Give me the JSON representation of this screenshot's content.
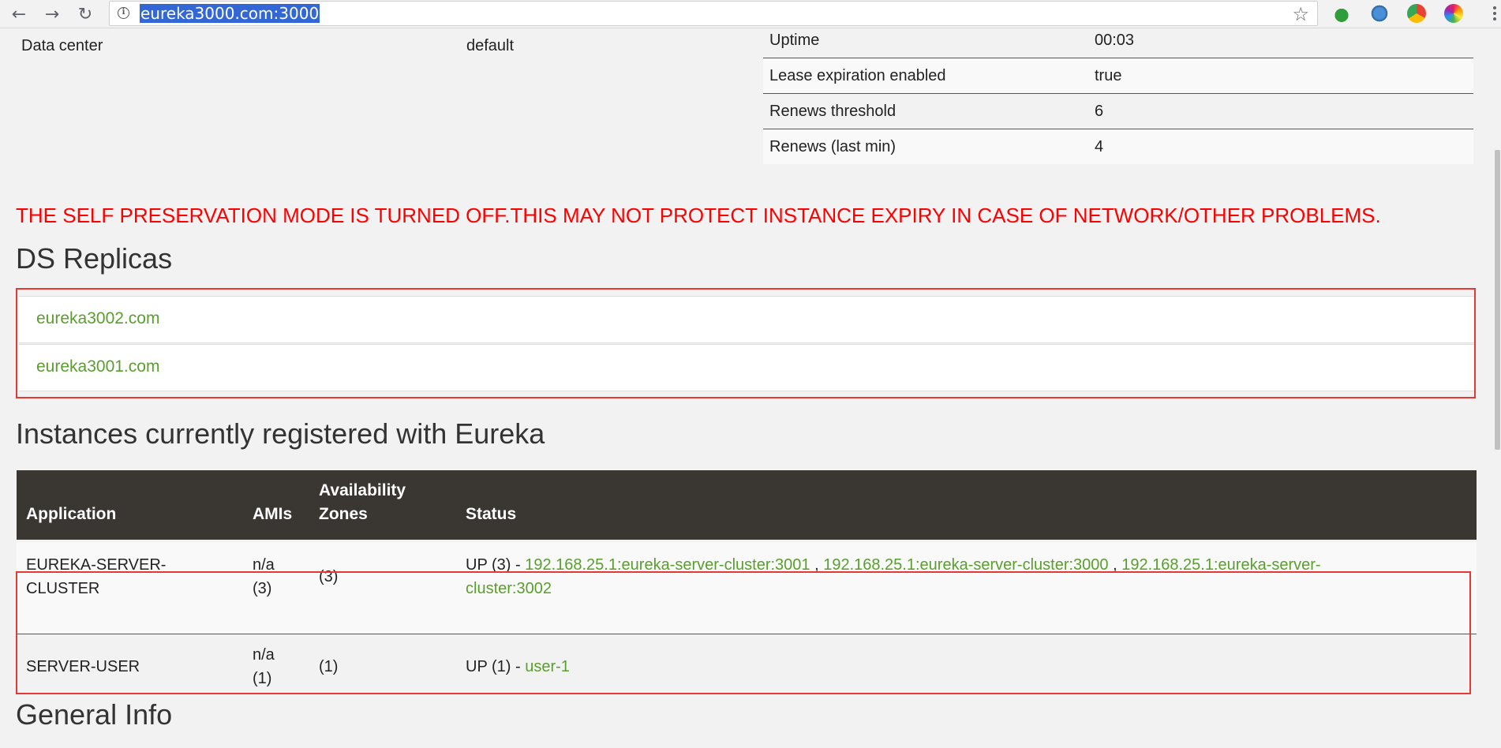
{
  "browser": {
    "url": "eureka3000.com:3000"
  },
  "top": {
    "data_center_label": "Data center",
    "data_center_value": "default",
    "stats": [
      {
        "key": "Uptime",
        "value": "00:03"
      },
      {
        "key": "Lease expiration enabled",
        "value": "true"
      },
      {
        "key": "Renews threshold",
        "value": "6"
      },
      {
        "key": "Renews (last min)",
        "value": "4"
      }
    ]
  },
  "warning": "THE SELF PRESERVATION MODE IS TURNED OFF.THIS MAY NOT PROTECT INSTANCE EXPIRY IN CASE OF NETWORK/OTHER PROBLEMS.",
  "replicas": {
    "title": "DS Replicas",
    "items": [
      "eureka3002.com",
      "eureka3001.com"
    ]
  },
  "instances": {
    "title": "Instances currently registered with Eureka",
    "headers": {
      "application": "Application",
      "amis": "AMIs",
      "zones_1": "Availability",
      "zones_2": "Zones",
      "status": "Status"
    },
    "rows": [
      {
        "application_1": "EUREKA-SERVER-",
        "application_2": "CLUSTER",
        "amis_1": "n/a",
        "amis_2": "(3)",
        "zones": "(3)",
        "status_prefix": "UP (3) - ",
        "link_1": "192.168.25.1:eureka-server-cluster:3001",
        "sep_1": " , ",
        "link_2": "192.168.25.1:eureka-server-cluster:3000",
        "sep_2": " , ",
        "link_3a": "192.168.25.1:eureka-server-",
        "link_3b": "cluster:3002"
      },
      {
        "application": "SERVER-USER",
        "amis_1": "n/a",
        "amis_2": "(1)",
        "zones": "(1)",
        "status_prefix": "UP (1) - ",
        "link_1": "user-1"
      }
    ]
  },
  "general_info": {
    "title": "General Info"
  },
  "colors": {
    "warning": "#ff0000",
    "link": "#5a9e2e",
    "header_bg": "#3a3632",
    "highlight_box": "#e53935"
  }
}
